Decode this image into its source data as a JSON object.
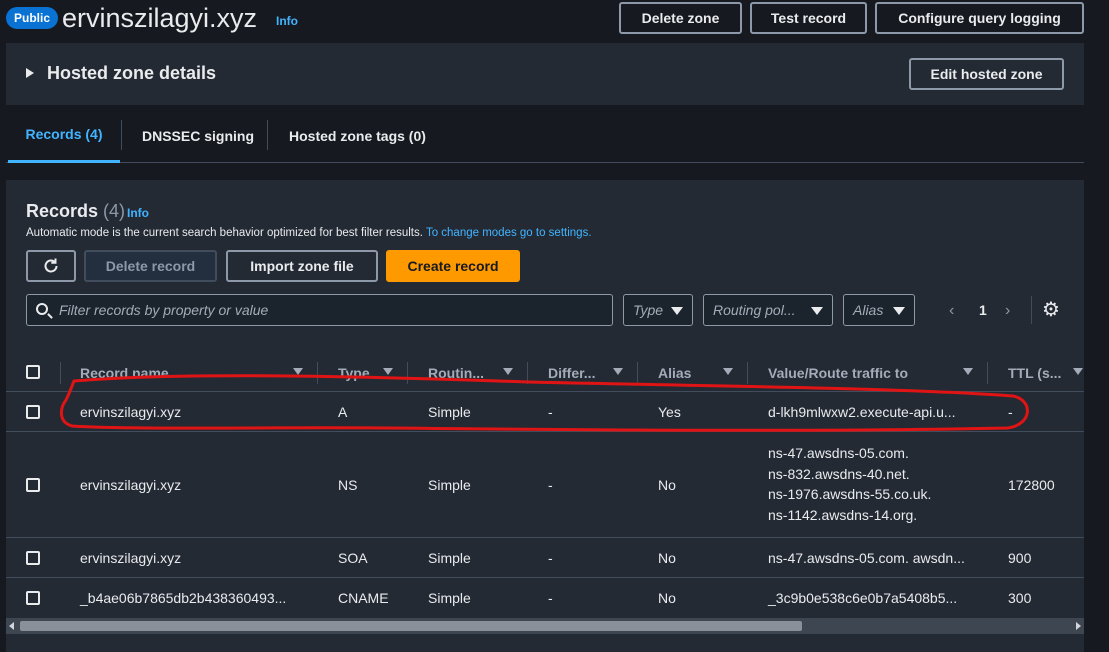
{
  "header": {
    "badge": "Public",
    "zone_name": "ervinszilagyi.xyz",
    "info": "Info",
    "buttons": {
      "delete_zone": "Delete zone",
      "test_record": "Test record",
      "configure_logging": "Configure query logging"
    }
  },
  "details": {
    "title": "Hosted zone details",
    "edit_button": "Edit hosted zone"
  },
  "tabs": [
    {
      "label": "Records (4)",
      "active": true
    },
    {
      "label": "DNSSEC signing",
      "active": false
    },
    {
      "label": "Hosted zone tags (0)",
      "active": false
    }
  ],
  "records": {
    "title": "Records",
    "count": "(4)",
    "info": "Info",
    "description": "Automatic mode is the current search behavior optimized for best filter results.",
    "description_link": "To change modes go to settings.",
    "buttons": {
      "refresh_icon": "refresh-icon",
      "delete": "Delete record",
      "import": "Import zone file",
      "create": "Create record"
    },
    "search_placeholder": "Filter records by property or value",
    "filters": {
      "type": "Type",
      "routing": "Routing pol...",
      "alias": "Alias"
    },
    "pager": {
      "prev": "‹",
      "page": "1",
      "next": "›"
    },
    "settings_icon": "gear-icon",
    "columns": [
      "Record name",
      "Type",
      "Routin...",
      "Differ...",
      "Alias",
      "Value/Route traffic to",
      "TTL (s..."
    ],
    "rows": [
      {
        "name": "ervinszilagyi.xyz",
        "type": "A",
        "routing": "Simple",
        "diff": "-",
        "alias": "Yes",
        "value": [
          "d-lkh9mlwxw2.execute-api.u..."
        ],
        "ttl": "-"
      },
      {
        "name": "ervinszilagyi.xyz",
        "type": "NS",
        "routing": "Simple",
        "diff": "-",
        "alias": "No",
        "value": [
          "ns-47.awsdns-05.com.",
          "ns-832.awsdns-40.net.",
          "ns-1976.awsdns-55.co.uk.",
          "ns-1142.awsdns-14.org."
        ],
        "ttl": "172800"
      },
      {
        "name": "ervinszilagyi.xyz",
        "type": "SOA",
        "routing": "Simple",
        "diff": "-",
        "alias": "No",
        "value": [
          "ns-47.awsdns-05.com. awsdn..."
        ],
        "ttl": "900"
      },
      {
        "name": "_b4ae06b7865db2b438360493...",
        "type": "CNAME",
        "routing": "Simple",
        "diff": "-",
        "alias": "No",
        "value": [
          "_3c9b0e538c6e0b7a5408b5..."
        ],
        "ttl": "300"
      }
    ]
  },
  "colors": {
    "accent": "#42b4ff",
    "primary": "#ff9900",
    "badge": "#0972d3",
    "annotation": "#e01414"
  }
}
